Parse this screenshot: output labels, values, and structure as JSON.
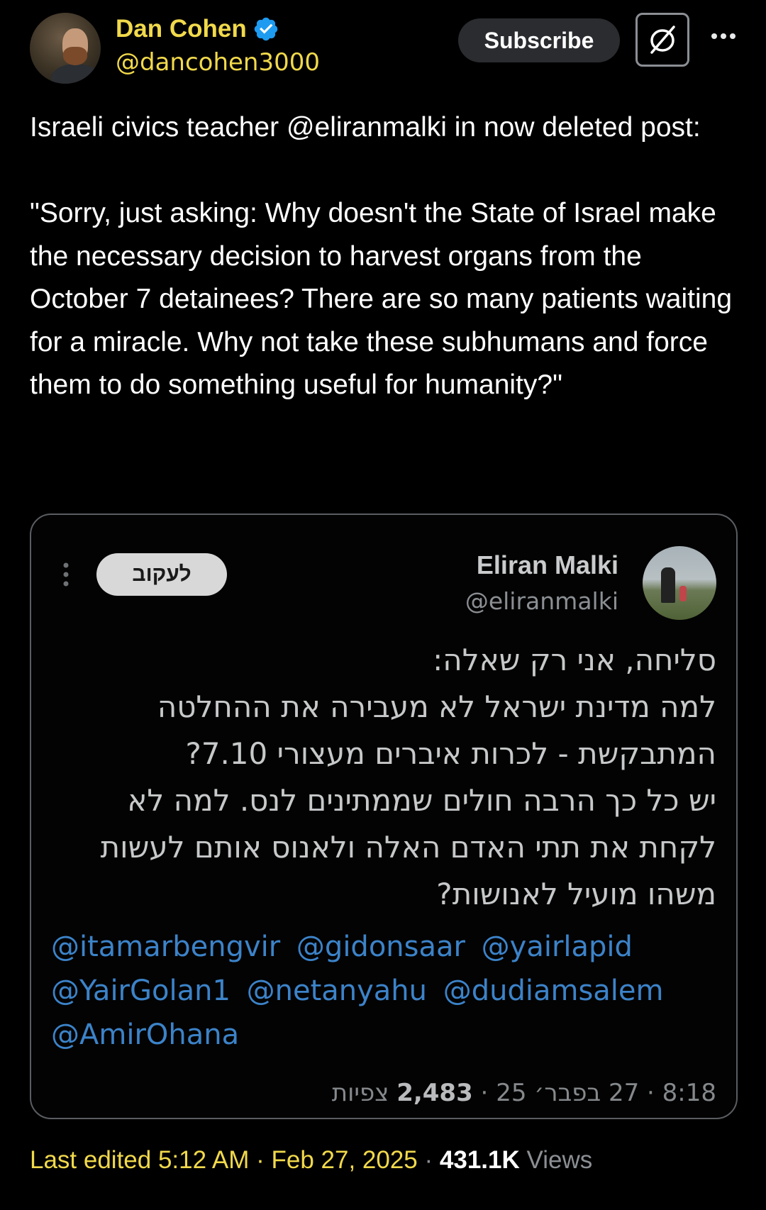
{
  "author": {
    "display_name": "Dan Cohen",
    "handle": "@dancohen3000",
    "verified": true,
    "accent_color": "#f1d94b"
  },
  "header": {
    "subscribe_label": "Subscribe",
    "grok_icon": "grok-slash-icon",
    "more_icon": "more-horizontal-icon"
  },
  "tweet": {
    "text": "Israeli civics teacher @eliranmalki in now deleted post:\n\n\"Sorry, just asking: Why doesn't the State of Israel make the necessary decision to harvest organs from the October 7 detainees? There are so many patients waiting for a miracle. Why not take these subhumans and force them to do something useful for humanity?\""
  },
  "quote": {
    "name": "Eliran Malki",
    "handle": "@eliranmalki",
    "follow_label": "לעקוב",
    "lines": [
      "סליחה, אני רק שאלה:",
      "למה מדינת ישראל לא מעבירה את ההחלטה",
      "המתבקשת - לכרות איברים מעצורי 7.10?",
      "יש כל כך הרבה חולים שממתינים לנס. למה לא",
      "לקחת את תתי האדם האלה ולאנוס אותם לעשות",
      "משהו מועיל לאנושות?"
    ],
    "mentions": [
      [
        "@itamarbengvir",
        "@gidonsaar",
        "@yairlapid"
      ],
      [
        "@YairGolan1",
        "@netanyahu",
        "@dudiamsalem"
      ],
      [
        "@AmirOhana"
      ]
    ],
    "time": "8:18",
    "date": "27 בפבר׳ 25",
    "views_count": "2,483",
    "views_label": "צפיות",
    "link_color": "#3c83c9"
  },
  "meta": {
    "edited_text": "Last edited 5:12 AM · Feb 27, 2025",
    "separator": "·",
    "views_count": "431.1K",
    "views_label": "Views"
  }
}
